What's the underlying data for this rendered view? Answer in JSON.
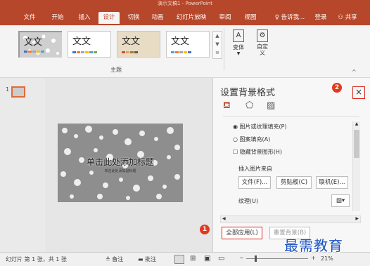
{
  "window": {
    "title": "演示文稿1 - PowerPoint"
  },
  "tabs": [
    {
      "label": "文件"
    },
    {
      "label": "开始"
    },
    {
      "label": "插入"
    },
    {
      "label": "设计",
      "active": true
    },
    {
      "label": "切换"
    },
    {
      "label": "动画"
    },
    {
      "label": "幻灯片放映"
    },
    {
      "label": "审阅"
    },
    {
      "label": "视图"
    }
  ],
  "tell_me": "告诉我...",
  "login": "登录",
  "share": "共享",
  "ribbon": {
    "themes": [
      {
        "label": "文文"
      },
      {
        "label": "文文"
      },
      {
        "label": "文文"
      },
      {
        "label": "文文"
      }
    ],
    "group_label": "主题",
    "variant_label": "变体",
    "custom_label": "自定义"
  },
  "slide_panel": {
    "slide_number": "1"
  },
  "slide": {
    "title": "单击此处添加标题",
    "subtitle": "单击此处添加副标题"
  },
  "format_pane": {
    "title": "设置背景格式",
    "options": {
      "picture_fill": "图片或纹理填充(P)",
      "pattern_fill": "图案填充(A)",
      "hide_graphics": "隐藏背景图形(H)"
    },
    "insert_from_label": "插入图片来自",
    "file_button": "文件(F)...",
    "clipboard_button": "剪贴板(C)",
    "online_button": "联机(E)...",
    "texture_label": "纹理(U)",
    "apply_all_button": "全部应用(L)",
    "reset_button": "重置背景(B)"
  },
  "status": {
    "slide_info": "幻灯片 第 1 张，共 1 张",
    "notes": "备注",
    "comments": "批注",
    "zoom": "21%"
  },
  "annotations": {
    "badge1": "1",
    "badge2": "2"
  },
  "watermark": "最需教育",
  "colors": {
    "accent": "#b7472a",
    "highlight": "#d9281f"
  }
}
